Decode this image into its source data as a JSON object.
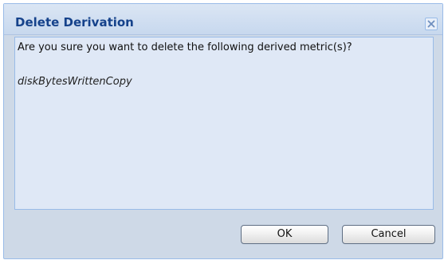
{
  "dialog": {
    "title": "Delete Derivation",
    "close_icon": "close-icon",
    "message": "Are you sure you want to delete the following derived metric(s)?",
    "metric_name": "diskBytesWrittenCopy",
    "ok_label": "OK",
    "cancel_label": "Cancel"
  },
  "colors": {
    "title_text": "#15428b",
    "dialog_border": "#99bbe8",
    "body_background": "#dfe8f6",
    "frame_background": "#ced9e7"
  }
}
